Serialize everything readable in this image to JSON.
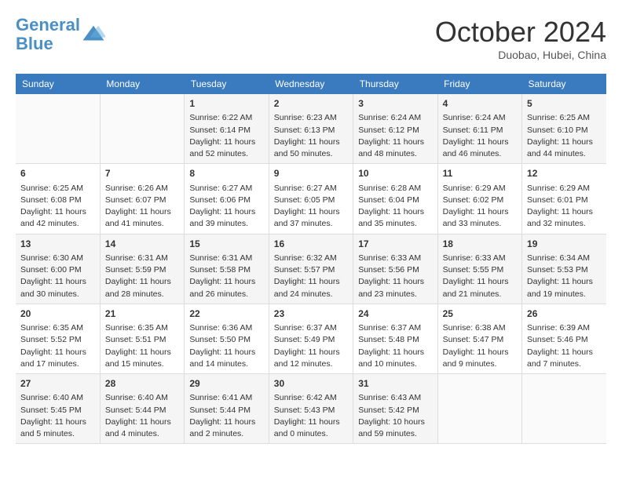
{
  "header": {
    "logo_line1": "General",
    "logo_line2": "Blue",
    "month": "October 2024",
    "location": "Duobao, Hubei, China"
  },
  "weekdays": [
    "Sunday",
    "Monday",
    "Tuesday",
    "Wednesday",
    "Thursday",
    "Friday",
    "Saturday"
  ],
  "weeks": [
    [
      {
        "day": "",
        "data": ""
      },
      {
        "day": "",
        "data": ""
      },
      {
        "day": "1",
        "data": "Sunrise: 6:22 AM\nSunset: 6:14 PM\nDaylight: 11 hours and 52 minutes."
      },
      {
        "day": "2",
        "data": "Sunrise: 6:23 AM\nSunset: 6:13 PM\nDaylight: 11 hours and 50 minutes."
      },
      {
        "day": "3",
        "data": "Sunrise: 6:24 AM\nSunset: 6:12 PM\nDaylight: 11 hours and 48 minutes."
      },
      {
        "day": "4",
        "data": "Sunrise: 6:24 AM\nSunset: 6:11 PM\nDaylight: 11 hours and 46 minutes."
      },
      {
        "day": "5",
        "data": "Sunrise: 6:25 AM\nSunset: 6:10 PM\nDaylight: 11 hours and 44 minutes."
      }
    ],
    [
      {
        "day": "6",
        "data": "Sunrise: 6:25 AM\nSunset: 6:08 PM\nDaylight: 11 hours and 42 minutes."
      },
      {
        "day": "7",
        "data": "Sunrise: 6:26 AM\nSunset: 6:07 PM\nDaylight: 11 hours and 41 minutes."
      },
      {
        "day": "8",
        "data": "Sunrise: 6:27 AM\nSunset: 6:06 PM\nDaylight: 11 hours and 39 minutes."
      },
      {
        "day": "9",
        "data": "Sunrise: 6:27 AM\nSunset: 6:05 PM\nDaylight: 11 hours and 37 minutes."
      },
      {
        "day": "10",
        "data": "Sunrise: 6:28 AM\nSunset: 6:04 PM\nDaylight: 11 hours and 35 minutes."
      },
      {
        "day": "11",
        "data": "Sunrise: 6:29 AM\nSunset: 6:02 PM\nDaylight: 11 hours and 33 minutes."
      },
      {
        "day": "12",
        "data": "Sunrise: 6:29 AM\nSunset: 6:01 PM\nDaylight: 11 hours and 32 minutes."
      }
    ],
    [
      {
        "day": "13",
        "data": "Sunrise: 6:30 AM\nSunset: 6:00 PM\nDaylight: 11 hours and 30 minutes."
      },
      {
        "day": "14",
        "data": "Sunrise: 6:31 AM\nSunset: 5:59 PM\nDaylight: 11 hours and 28 minutes."
      },
      {
        "day": "15",
        "data": "Sunrise: 6:31 AM\nSunset: 5:58 PM\nDaylight: 11 hours and 26 minutes."
      },
      {
        "day": "16",
        "data": "Sunrise: 6:32 AM\nSunset: 5:57 PM\nDaylight: 11 hours and 24 minutes."
      },
      {
        "day": "17",
        "data": "Sunrise: 6:33 AM\nSunset: 5:56 PM\nDaylight: 11 hours and 23 minutes."
      },
      {
        "day": "18",
        "data": "Sunrise: 6:33 AM\nSunset: 5:55 PM\nDaylight: 11 hours and 21 minutes."
      },
      {
        "day": "19",
        "data": "Sunrise: 6:34 AM\nSunset: 5:53 PM\nDaylight: 11 hours and 19 minutes."
      }
    ],
    [
      {
        "day": "20",
        "data": "Sunrise: 6:35 AM\nSunset: 5:52 PM\nDaylight: 11 hours and 17 minutes."
      },
      {
        "day": "21",
        "data": "Sunrise: 6:35 AM\nSunset: 5:51 PM\nDaylight: 11 hours and 15 minutes."
      },
      {
        "day": "22",
        "data": "Sunrise: 6:36 AM\nSunset: 5:50 PM\nDaylight: 11 hours and 14 minutes."
      },
      {
        "day": "23",
        "data": "Sunrise: 6:37 AM\nSunset: 5:49 PM\nDaylight: 11 hours and 12 minutes."
      },
      {
        "day": "24",
        "data": "Sunrise: 6:37 AM\nSunset: 5:48 PM\nDaylight: 11 hours and 10 minutes."
      },
      {
        "day": "25",
        "data": "Sunrise: 6:38 AM\nSunset: 5:47 PM\nDaylight: 11 hours and 9 minutes."
      },
      {
        "day": "26",
        "data": "Sunrise: 6:39 AM\nSunset: 5:46 PM\nDaylight: 11 hours and 7 minutes."
      }
    ],
    [
      {
        "day": "27",
        "data": "Sunrise: 6:40 AM\nSunset: 5:45 PM\nDaylight: 11 hours and 5 minutes."
      },
      {
        "day": "28",
        "data": "Sunrise: 6:40 AM\nSunset: 5:44 PM\nDaylight: 11 hours and 4 minutes."
      },
      {
        "day": "29",
        "data": "Sunrise: 6:41 AM\nSunset: 5:44 PM\nDaylight: 11 hours and 2 minutes."
      },
      {
        "day": "30",
        "data": "Sunrise: 6:42 AM\nSunset: 5:43 PM\nDaylight: 11 hours and 0 minutes."
      },
      {
        "day": "31",
        "data": "Sunrise: 6:43 AM\nSunset: 5:42 PM\nDaylight: 10 hours and 59 minutes."
      },
      {
        "day": "",
        "data": ""
      },
      {
        "day": "",
        "data": ""
      }
    ]
  ]
}
